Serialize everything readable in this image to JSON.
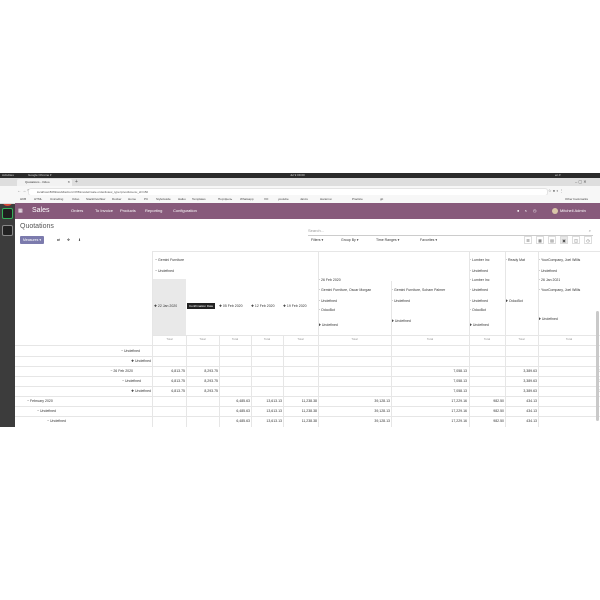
{
  "os_bar": {
    "activities": "Activities",
    "app": "Google Chrome ▾",
    "clock": "Jul 9 09:00",
    "status": "en ▾"
  },
  "browser": {
    "tab_title": "Quotations - Odoo",
    "new_tab": "+",
    "url": "localhost:8069/web#action=378&model=sale.order&view_type=pivot&menu_id=150",
    "bookmarks": [
      "HKB",
      "HTML",
      "Unicoding",
      "Odoo",
      "StackOverflow",
      "Docker",
      "Home",
      "PC",
      "StyleGuide",
      "Haiku",
      "Templates",
      "Портфель",
      "Whatsapp",
      "XO",
      "youtube",
      "Jarvis",
      "Напитки",
      "Practice",
      "git"
    ],
    "other_bookmarks": "Other bookmarks"
  },
  "odoo": {
    "app_name": "Sales",
    "menu": [
      "Orders",
      "To Invoice",
      "Products",
      "Reporting",
      "Configuration"
    ],
    "user": "Mitchell Admin",
    "badge": "5"
  },
  "control": {
    "breadcrumb": "Quotations",
    "search_placeholder": "Search...",
    "measures": "Measures ▾",
    "filters": "Filters ▾",
    "group_by": "Group By ▾",
    "time_ranges": "Time Ranges ▾",
    "favorites": "Favorites ▾"
  },
  "pivot": {
    "col_headers": {
      "level1": [
        "Gemini Furniture",
        "Lumber Inc",
        "Ready Mat",
        "YourCompany, Joel Willis"
      ],
      "level2": [
        "Undefined",
        "Undefined",
        "Undefined"
      ],
      "level3": [
        "26 Feb 2020",
        "Lumber Inc",
        "26 Jan 2021"
      ],
      "level4": [
        "Gemini Furniture, Oscar Morgan",
        "Gemini Furniture, Soham Palmer",
        "Undefined",
        "YourCompany, Joel Willis"
      ],
      "level5": [
        "Undefined",
        "Undefined",
        "Undefined",
        "OdooBot"
      ],
      "level6": [
        "OdooBot",
        "Undefined",
        "OdooBot",
        "Undefined"
      ],
      "level7": [
        "Undefined",
        "Undefined",
        "Undefined"
      ],
      "dates": [
        "22 Jan 2020",
        "05 Feb 2020",
        "12 Feb 2020",
        "19 Feb 2020"
      ],
      "tooltip": "Confirmation Date",
      "measure": "Total"
    },
    "rows": [
      {
        "label": "Undefined",
        "values": [
          "",
          "",
          "",
          "",
          "",
          "",
          "",
          "",
          "",
          "",
          ""
        ]
      },
      {
        "label": "Undefined",
        "values": [
          "",
          "",
          "",
          "",
          "",
          "",
          "",
          "",
          "",
          "",
          ""
        ]
      },
      {
        "label": "26 Feb 2020",
        "values": [
          "6,813.75",
          "8,293.75",
          "",
          "",
          "",
          "7,058.13",
          "",
          "",
          "3,389.63",
          "3,389.63"
        ]
      },
      {
        "label": "Undefined",
        "values": [
          "6,813.75",
          "8,293.75",
          "",
          "",
          "",
          "7,058.13",
          "",
          "",
          "3,389.63",
          "3,389.63"
        ]
      },
      {
        "label": "Undefined",
        "values": [
          "6,813.75",
          "8,293.75",
          "",
          "",
          "",
          "7,058.13",
          "",
          "",
          "3,389.63",
          "3,389.63"
        ]
      },
      {
        "label": "February 2020",
        "values": [
          "",
          "",
          "6,485.63",
          "13,613.13",
          "11,238.38",
          "39,128.13",
          "17,229.16",
          "982.50",
          "434.13",
          ""
        ]
      },
      {
        "label": "Undefined",
        "values": [
          "",
          "",
          "6,485.63",
          "13,613.13",
          "11,238.38",
          "39,128.13",
          "17,229.16",
          "982.50",
          "434.13",
          ""
        ]
      },
      {
        "label": "Undefined",
        "values": [
          "",
          "",
          "6,485.63",
          "13,613.13",
          "11,238.38",
          "39,128.13",
          "17,229.16",
          "982.50",
          "434.13",
          ""
        ]
      }
    ]
  }
}
